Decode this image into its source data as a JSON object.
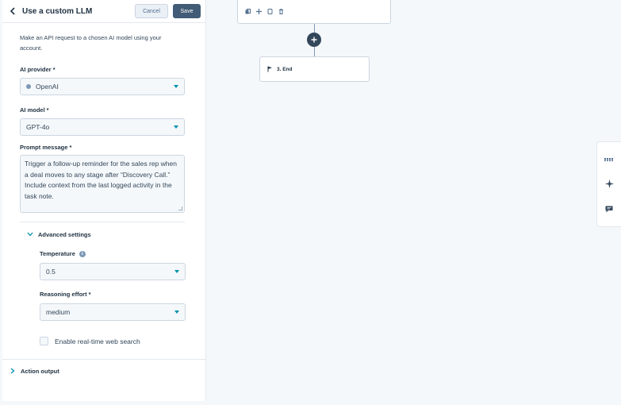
{
  "panel": {
    "title": "Use a custom LLM",
    "cancel_label": "Cancel",
    "save_label": "Save",
    "description": "Make an API request to a chosen AI model using your account."
  },
  "fields": {
    "provider": {
      "label": "AI provider",
      "required_mark": "*",
      "value": "OpenAI"
    },
    "model": {
      "label": "AI model",
      "required_mark": "*",
      "value": "GPT-4o"
    },
    "prompt": {
      "label": "Prompt message",
      "required_mark": "*",
      "value": "Trigger a follow-up reminder for the sales rep when a deal moves to any stage after “Discovery Call.” Include context from the last logged activity in the task note."
    }
  },
  "advanced": {
    "label": "Advanced settings",
    "temperature": {
      "label": "Temperature",
      "value": "0.5"
    },
    "reasoning": {
      "label": "Reasoning effort",
      "required_mark": "*",
      "value": "medium"
    },
    "web_search_label": "Enable real-time web search"
  },
  "action_output": {
    "label": "Action output"
  },
  "canvas": {
    "end_step_label": "3. End"
  },
  "colors": {
    "accent": "#0091ae",
    "primary_button": "#425b76",
    "text": "#33475b",
    "canvas_bg": "#f5f8fa"
  },
  "icons": {
    "back": "chevron-left-icon",
    "toolbar": [
      "copy-icon",
      "move-icon",
      "clone-icon",
      "trash-icon"
    ],
    "add": "plus-icon",
    "end": "flag-icon",
    "rail": [
      "grid-icon",
      "sparkle-icon",
      "comment-icon"
    ]
  }
}
